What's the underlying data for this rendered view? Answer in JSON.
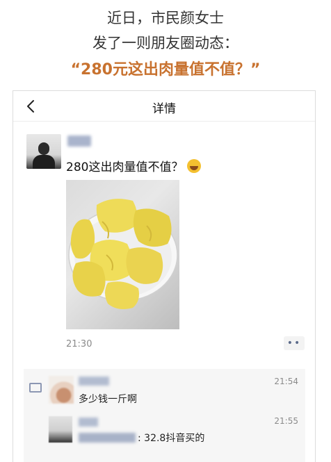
{
  "headline": {
    "line1": "近日，市民颜女士",
    "line2": "发了一则朋友圈动态：",
    "line3": "“280元这出肉量值不值？”"
  },
  "nav": {
    "title": "详情",
    "back_icon": "chevron-left-icon"
  },
  "post": {
    "text": "280这出肉量值不值？",
    "emoji": "laughing-face-emoji",
    "time": "21:30",
    "more_icon": "more-dots-icon"
  },
  "comments": [
    {
      "text": "多少钱一斤啊",
      "time": "21:54"
    },
    {
      "text": ": 32.8抖音买的",
      "time": "21:55"
    }
  ],
  "colors": {
    "accent": "#c8722f",
    "link_blue": "#5b6a8a",
    "durian_yellow": "#e9d34a"
  }
}
